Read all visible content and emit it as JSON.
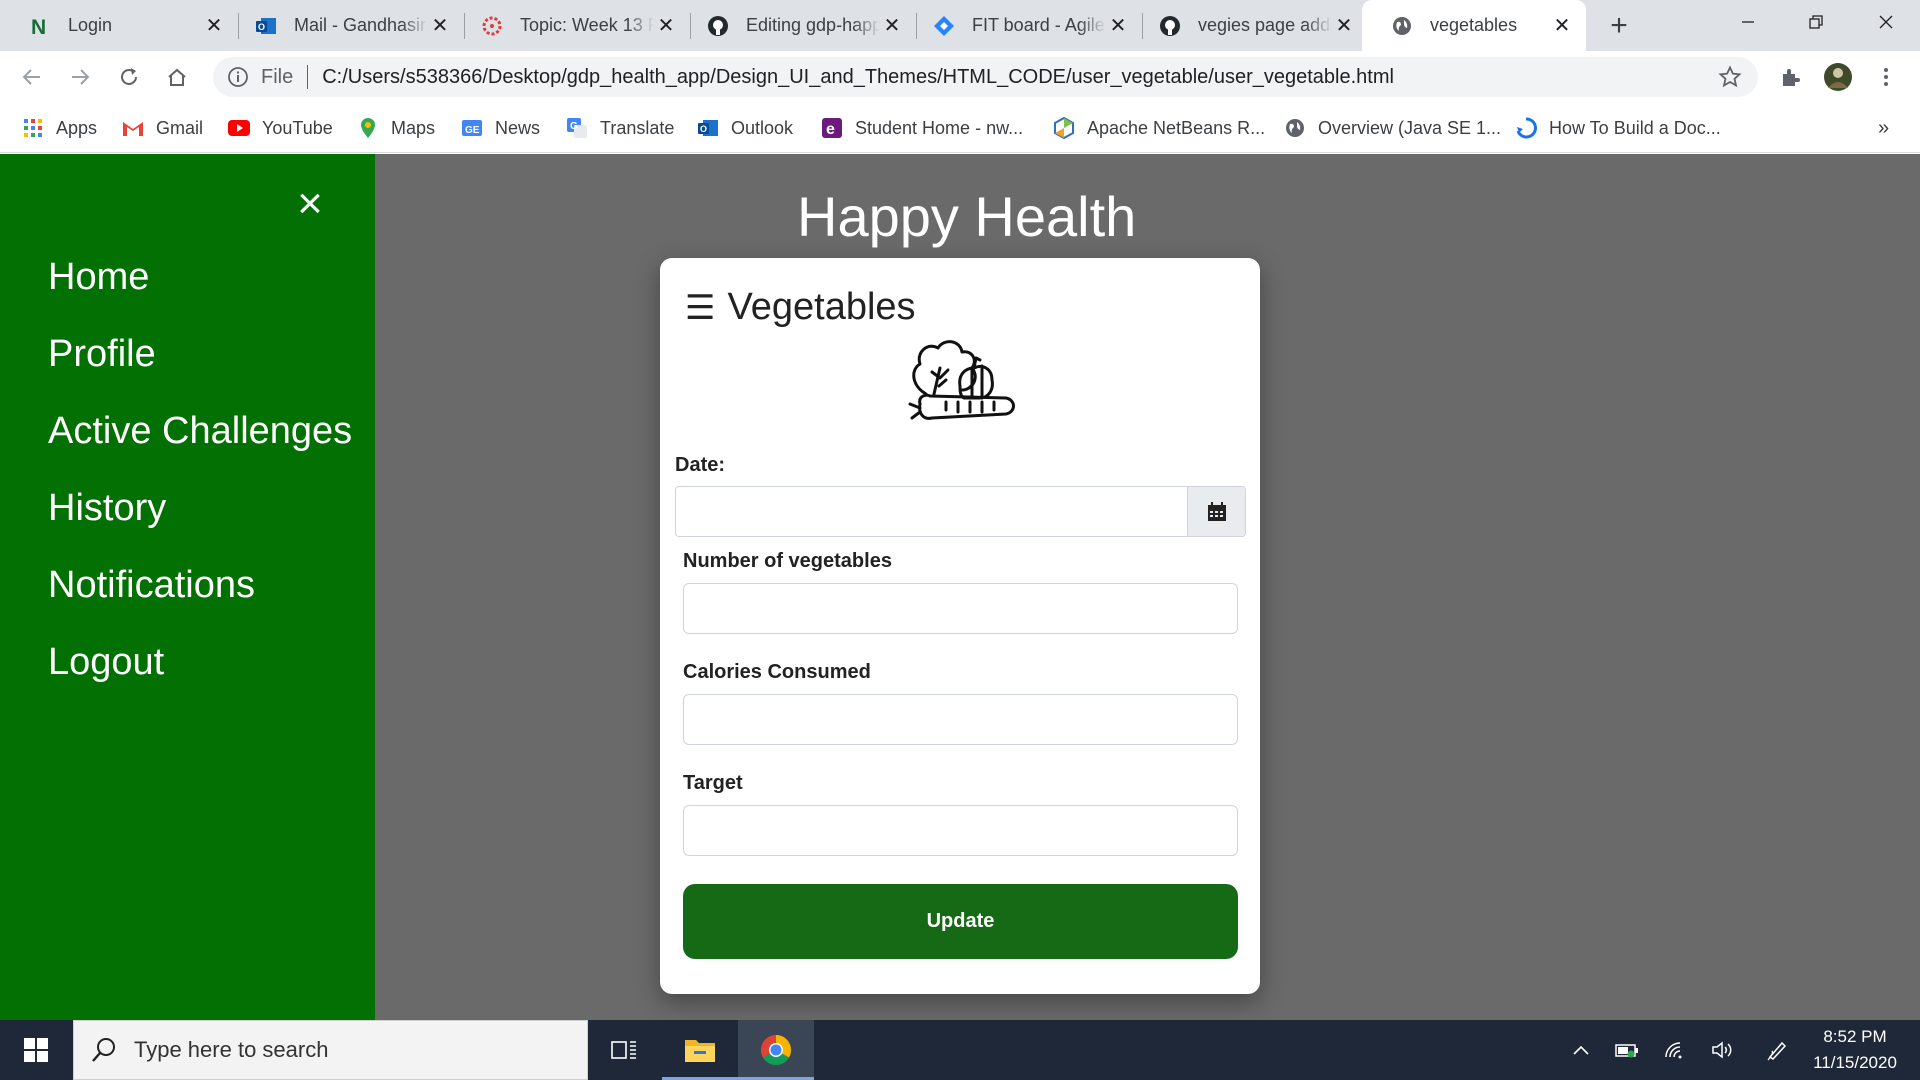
{
  "browser": {
    "tabs": [
      {
        "title": "Login",
        "icon": "notion-icon"
      },
      {
        "title": "Mail - Gandhasiri",
        "icon": "outlook-icon"
      },
      {
        "title": "Topic: Week 13 Pr",
        "icon": "canvas-icon"
      },
      {
        "title": "Editing gdp-happ",
        "icon": "github-icon"
      },
      {
        "title": "FIT board - Agile",
        "icon": "jira-icon"
      },
      {
        "title": "vegies page addi",
        "icon": "github-icon"
      },
      {
        "title": "vegetables",
        "icon": "globe-icon",
        "active": true
      }
    ],
    "address": {
      "scheme": "File",
      "url": "C:/Users/s538366/Desktop/gdp_health_app/Design_UI_and_Themes/HTML_CODE/user_vegetable/user_vegetable.html"
    },
    "bookmarks": [
      {
        "label": "Apps",
        "icon": "apps-grid-icon"
      },
      {
        "label": "Gmail",
        "icon": "gmail-icon"
      },
      {
        "label": "YouTube",
        "icon": "youtube-icon"
      },
      {
        "label": "Maps",
        "icon": "maps-pin-icon"
      },
      {
        "label": "News",
        "icon": "news-icon"
      },
      {
        "label": "Translate",
        "icon": "translate-icon"
      },
      {
        "label": "Outlook",
        "icon": "outlook-icon"
      },
      {
        "label": "Student Home - nw...",
        "icon": "student-icon"
      },
      {
        "label": "Apache NetBeans R...",
        "icon": "netbeans-icon"
      },
      {
        "label": "Overview (Java SE 1...",
        "icon": "globe-icon"
      },
      {
        "label": "How To Build a Doc...",
        "icon": "doc-icon"
      }
    ],
    "more_label": "»"
  },
  "page": {
    "app_title": "Happy Health",
    "sidenav": {
      "close": "×",
      "items": [
        "Home",
        "Profile",
        "Active Challenges",
        "History",
        "Notifications",
        "Logout"
      ]
    },
    "card": {
      "menu_glyph": "☰",
      "title": "Vegetables",
      "date_label": "Date:",
      "date_value": "",
      "count_label": "Number of vegetables",
      "count_value": "",
      "calories_label": "Calories Consumed",
      "calories_value": "",
      "target_label": "Target",
      "target_value": "",
      "update_label": "Update"
    }
  },
  "taskbar": {
    "search_placeholder": "Type here to search",
    "time": "8:52 PM",
    "date": "11/15/2020"
  },
  "colors": {
    "sidenav_bg": "#037003",
    "overlay_bg": "#6a6a6a",
    "button_bg": "#166a16",
    "taskbar_bg": "#1e2838"
  }
}
